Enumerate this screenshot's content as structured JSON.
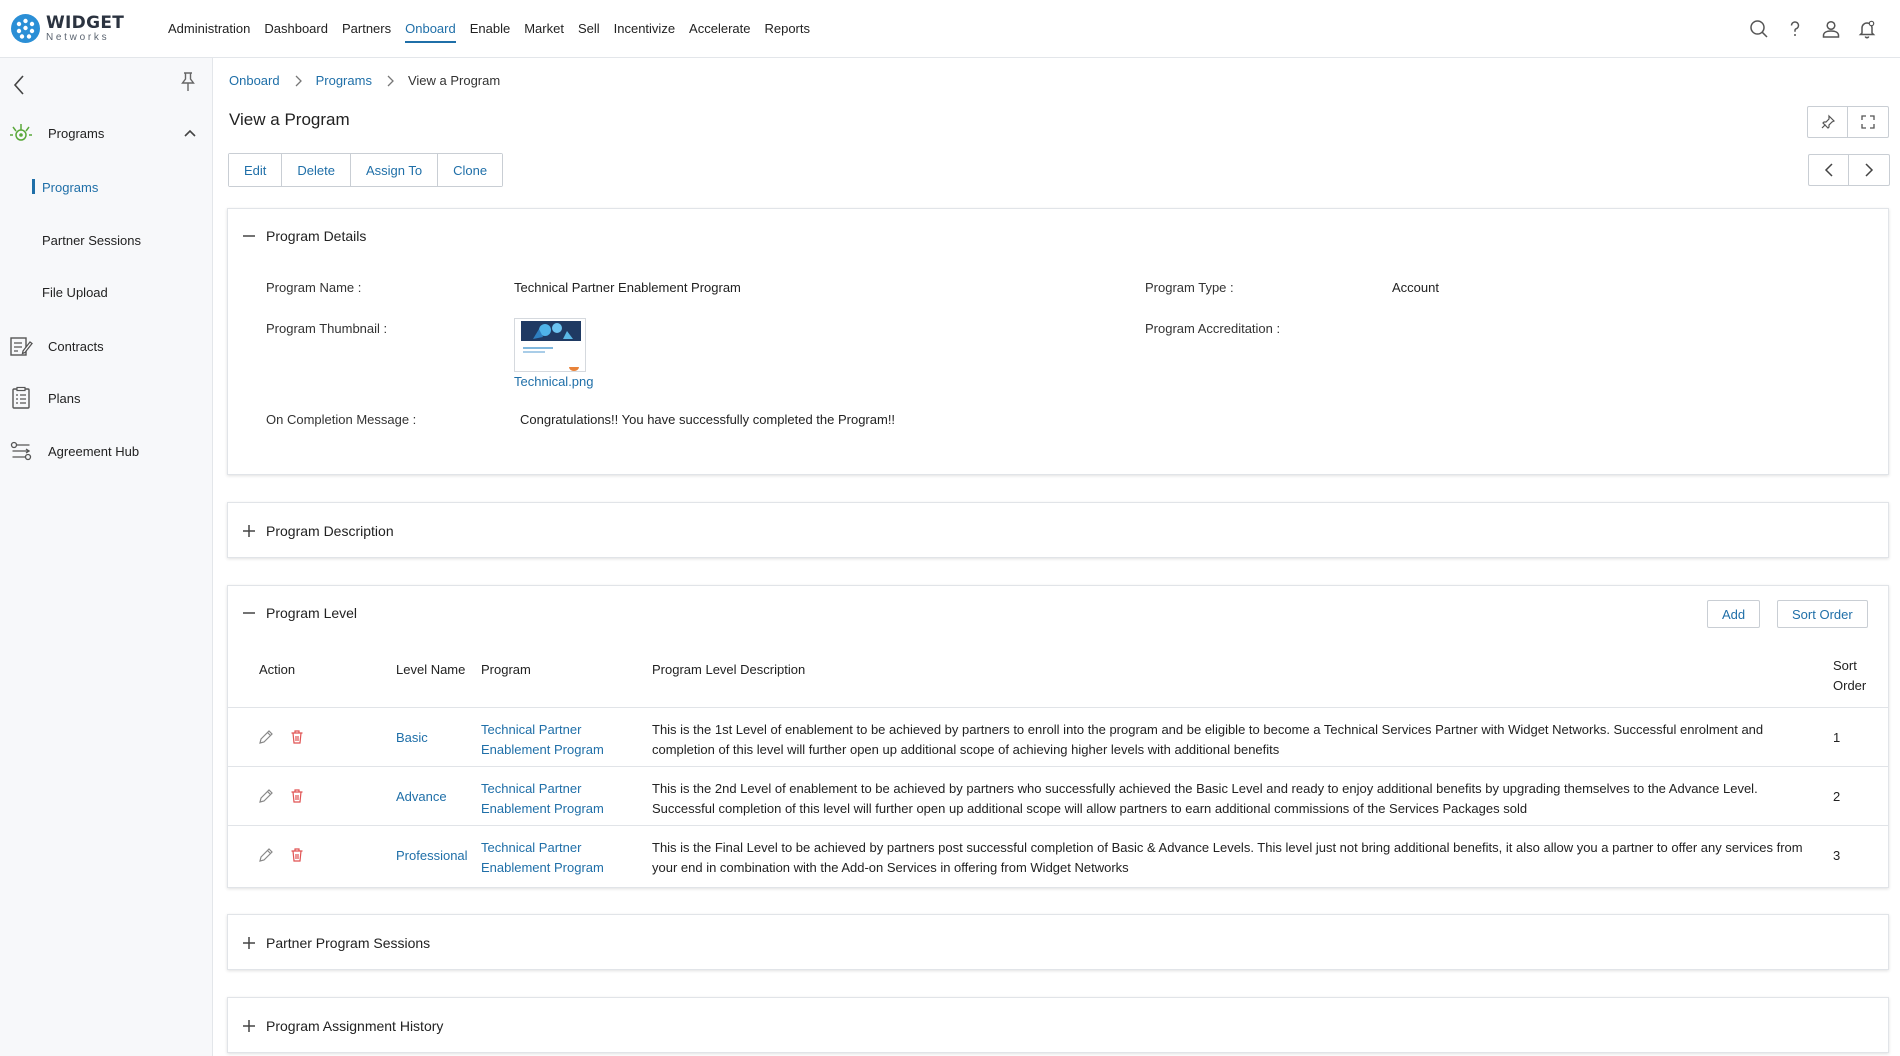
{
  "brand": {
    "name": "WIDGET",
    "sub": "Networks",
    "color": "#2b8fd6"
  },
  "nav": {
    "items": [
      "Administration",
      "Dashboard",
      "Partners",
      "Onboard",
      "Enable",
      "Market",
      "Sell",
      "Incentivize",
      "Accelerate",
      "Reports"
    ],
    "active": "Onboard"
  },
  "top_icons": [
    "search-icon",
    "help-icon",
    "user-icon",
    "bell-icon"
  ],
  "sidebar": {
    "groups": [
      {
        "label": "Programs",
        "icon": "programs-icon",
        "expanded": true
      },
      {
        "label": "Contracts",
        "icon": "contracts-icon"
      },
      {
        "label": "Plans",
        "icon": "plans-icon"
      },
      {
        "label": "Agreement Hub",
        "icon": "agreement-hub-icon"
      }
    ],
    "subitems": [
      "Programs",
      "Partner Sessions",
      "File Upload"
    ],
    "active_subitem": "Programs"
  },
  "breadcrumb": {
    "items": [
      "Onboard",
      "Programs"
    ],
    "current": "View a Program"
  },
  "page_title": "View a Program",
  "actions": {
    "edit": "Edit",
    "delete": "Delete",
    "assign": "Assign To",
    "clone": "Clone"
  },
  "program_details": {
    "title": "Program Details",
    "name_label": "Program Name :",
    "name_value": "Technical Partner Enablement Program",
    "type_label": "Program Type :",
    "type_value": "Account",
    "thumb_label": "Program Thumbnail :",
    "thumb_file": "Technical.png",
    "accreditation_label": "Program Accreditation :",
    "completion_label": "On Completion Message :",
    "completion_value": "Congratulations!! You have successfully completed the Program!!"
  },
  "program_description": {
    "title": "Program Description"
  },
  "program_level": {
    "title": "Program Level",
    "add_label": "Add",
    "sort_label": "Sort Order",
    "headers": {
      "action": "Action",
      "level_name": "Level Name",
      "program": "Program",
      "description": "Program Level Description",
      "sort_1": "Sort",
      "sort_2": "Order"
    },
    "rows": [
      {
        "level": "Basic",
        "program": "Technical Partner Enablement Program",
        "description": "This is the 1st Level of enablement to be achieved by partners to enroll into the program and be eligible to become a Technical Services Partner with Widget Networks. Successful enrolment and completion of this level will further open up additional scope of achieving higher levels with additional benefits",
        "sort": "1"
      },
      {
        "level": "Advance",
        "program": "Technical Partner Enablement Program",
        "description": "This is the 2nd Level of enablement to be achieved by partners who successfully achieved the Basic Level and ready to enjoy additional benefits by upgrading themselves to the Advance Level. Successful completion of this level will further open up additional scope will allow partners to earn additional commissions of the Services Packages sold",
        "sort": "2"
      },
      {
        "level": "Professional",
        "program": "Technical Partner Enablement Program",
        "description": "This is the Final Level to be achieved by partners post successful completion of Basic & Advance Levels. This level just not bring additional benefits, it also allow you a partner to offer any services from your end in combination with the Add-on Services in offering from Widget Networks",
        "sort": "3"
      }
    ]
  },
  "partner_program_sessions": {
    "title": "Partner Program Sessions"
  },
  "program_assignment_history": {
    "title": "Program Assignment History"
  },
  "colors": {
    "link": "#1f6fa8",
    "delete": "#e05252",
    "text": "#222222"
  }
}
